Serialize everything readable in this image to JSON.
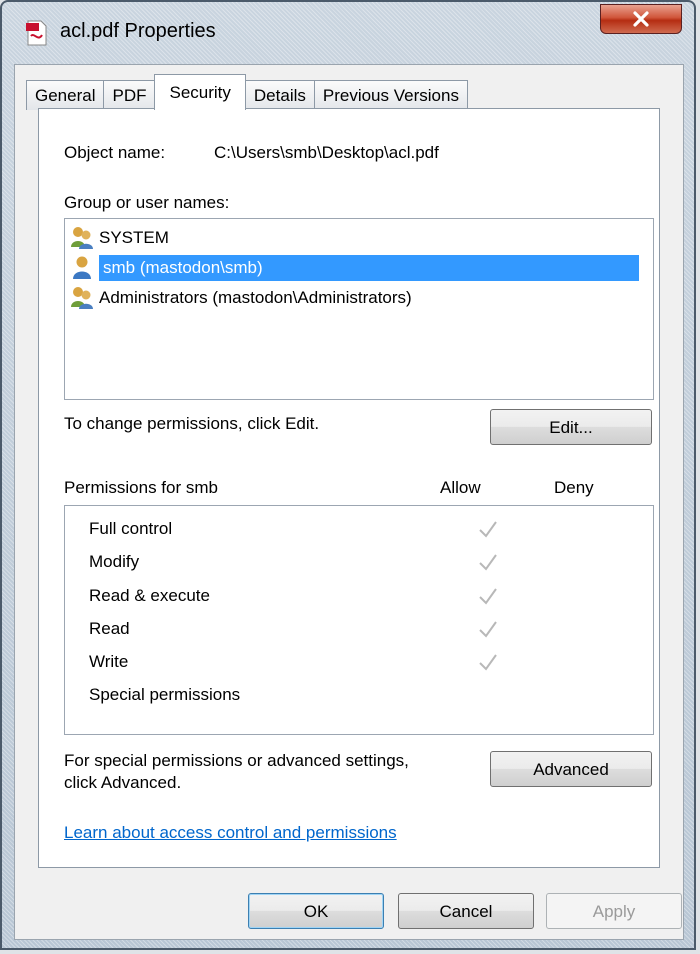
{
  "window": {
    "title": "acl.pdf Properties",
    "close_glyph": "X"
  },
  "tabs": [
    {
      "label": "General"
    },
    {
      "label": "PDF"
    },
    {
      "label": "Security"
    },
    {
      "label": "Details"
    },
    {
      "label": "Previous Versions"
    }
  ],
  "security": {
    "object_name_label": "Object name:",
    "object_name_value": "C:\\Users\\smb\\Desktop\\acl.pdf",
    "group_label": "Group or user names:",
    "users": [
      {
        "label": "SYSTEM",
        "icon": "users-group-icon"
      },
      {
        "label": "smb (mastodon\\smb)",
        "icon": "user-icon"
      },
      {
        "label": "Administrators (mastodon\\Administrators)",
        "icon": "users-group-icon"
      }
    ],
    "change_hint": "To change permissions, click Edit.",
    "edit_button": "Edit...",
    "permissions_header": "Permissions for smb",
    "allow_header": "Allow",
    "deny_header": "Deny",
    "permissions": [
      {
        "label": "Full control",
        "allow": true
      },
      {
        "label": "Modify",
        "allow": true
      },
      {
        "label": "Read & execute",
        "allow": true
      },
      {
        "label": "Read",
        "allow": true
      },
      {
        "label": "Write",
        "allow": true
      },
      {
        "label": "Special permissions",
        "allow": false
      }
    ],
    "advanced_hint_line1": "For special permissions or advanced settings,",
    "advanced_hint_line2": "click Advanced.",
    "advanced_button": "Advanced",
    "learn_link": "Learn about access control and permissions"
  },
  "footer": {
    "ok": "OK",
    "cancel": "Cancel",
    "apply": "Apply"
  },
  "colors": {
    "selection": "#3399ff",
    "link": "#0066cc"
  }
}
